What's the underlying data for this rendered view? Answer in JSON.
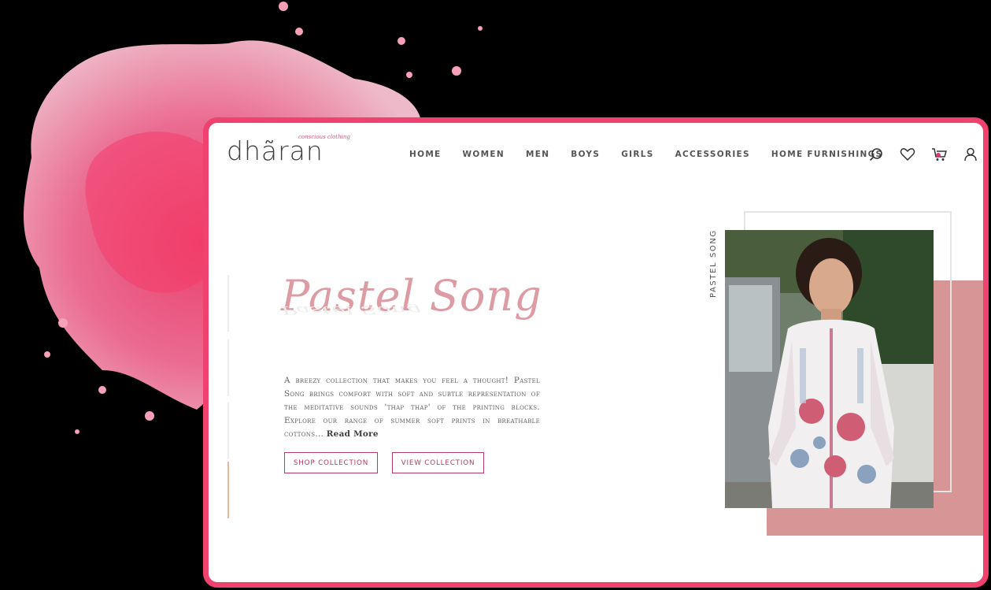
{
  "brand": {
    "name": "dhãran",
    "tagline": "conscious clothing"
  },
  "nav": {
    "items": [
      "HOME",
      "WOMEN",
      "MEN",
      "BOYS",
      "GIRLS",
      "ACCESSORIES",
      "HOME FURNISHINGS"
    ]
  },
  "header_icons": [
    "search-icon",
    "heart-icon",
    "cart-icon",
    "user-icon"
  ],
  "hero": {
    "title": "Pastel Song",
    "description": "A breezy collection that makes you feel a thought! Pastel Song brings comfort with soft and subtle representation of the meditative sounds 'thap thap' of the printing blocks. Explore our range of summer soft prints in breathable cottons...",
    "read_more": "Read More",
    "shop_button": "SHOP COLLECTION",
    "view_button": "VIEW COLLECTION",
    "vertical_label": "PASTEL SONG"
  },
  "colors": {
    "frame": "#f0426f",
    "accent": "#b43a68",
    "title": "#dd9ca4",
    "block": "#d79695"
  }
}
